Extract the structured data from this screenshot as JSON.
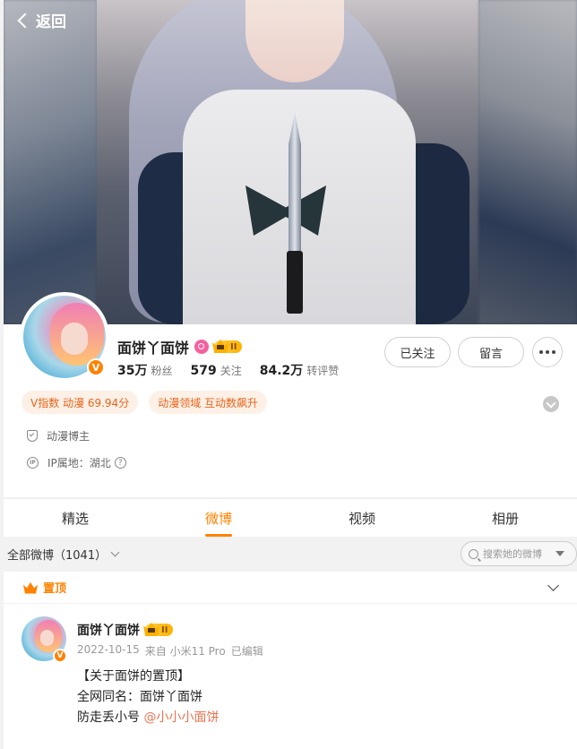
{
  "header": {
    "back_label": "返回"
  },
  "profile": {
    "name": "面饼丫面饼",
    "vip_level": "II",
    "verified_mark": "V",
    "stats": [
      {
        "value": "35万",
        "label": "粉丝"
      },
      {
        "value": "579",
        "label": "关注"
      },
      {
        "value": "84.2万",
        "label": "转评赞"
      }
    ],
    "buttons": {
      "followed": "已关注",
      "message": "留言"
    },
    "tags": [
      "V指数 动漫 69.94分",
      "动漫领域 互动数飙升"
    ],
    "role": "动漫博主",
    "ip_label": "IP属地：湖北",
    "ip_icon_text": "IP",
    "help_icon_text": "?"
  },
  "tabs": [
    {
      "label": "精选",
      "active": false
    },
    {
      "label": "微博",
      "active": true
    },
    {
      "label": "视频",
      "active": false
    },
    {
      "label": "相册",
      "active": false
    }
  ],
  "filter": {
    "all_label": "全部微博（1041）",
    "search_placeholder": "搜索她的微博"
  },
  "post": {
    "pinned_label": "置顶",
    "author": "面饼丫面饼",
    "vip_level": "II",
    "verified_mark": "V",
    "date": "2022-10-15",
    "source": "来自 小米11 Pro",
    "edited": "已编辑",
    "lines": [
      "【关于面饼的置顶】",
      "全网同名：面饼丫面饼",
      "防走丢小号 "
    ],
    "mention": "@小小小面饼"
  },
  "colors": {
    "accent": "#ff8200",
    "tag_text": "#e8641b",
    "tag_bg": "#fdf0e6",
    "mention": "#eb7350"
  }
}
